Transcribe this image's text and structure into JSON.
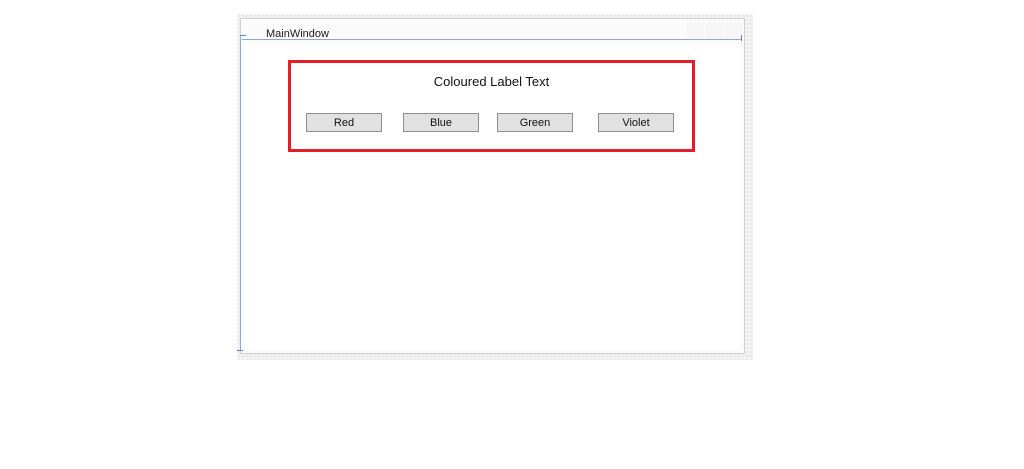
{
  "window": {
    "title": "MainWindow"
  },
  "label": {
    "text": "Coloured Label Text"
  },
  "buttons": [
    {
      "label": "Red"
    },
    {
      "label": "Blue"
    },
    {
      "label": "Green"
    },
    {
      "label": "Violet"
    }
  ],
  "colors": {
    "highlight_border": "#e41e26",
    "button_face": "#e1e1e1",
    "guide_line": "#8aa7d6"
  }
}
